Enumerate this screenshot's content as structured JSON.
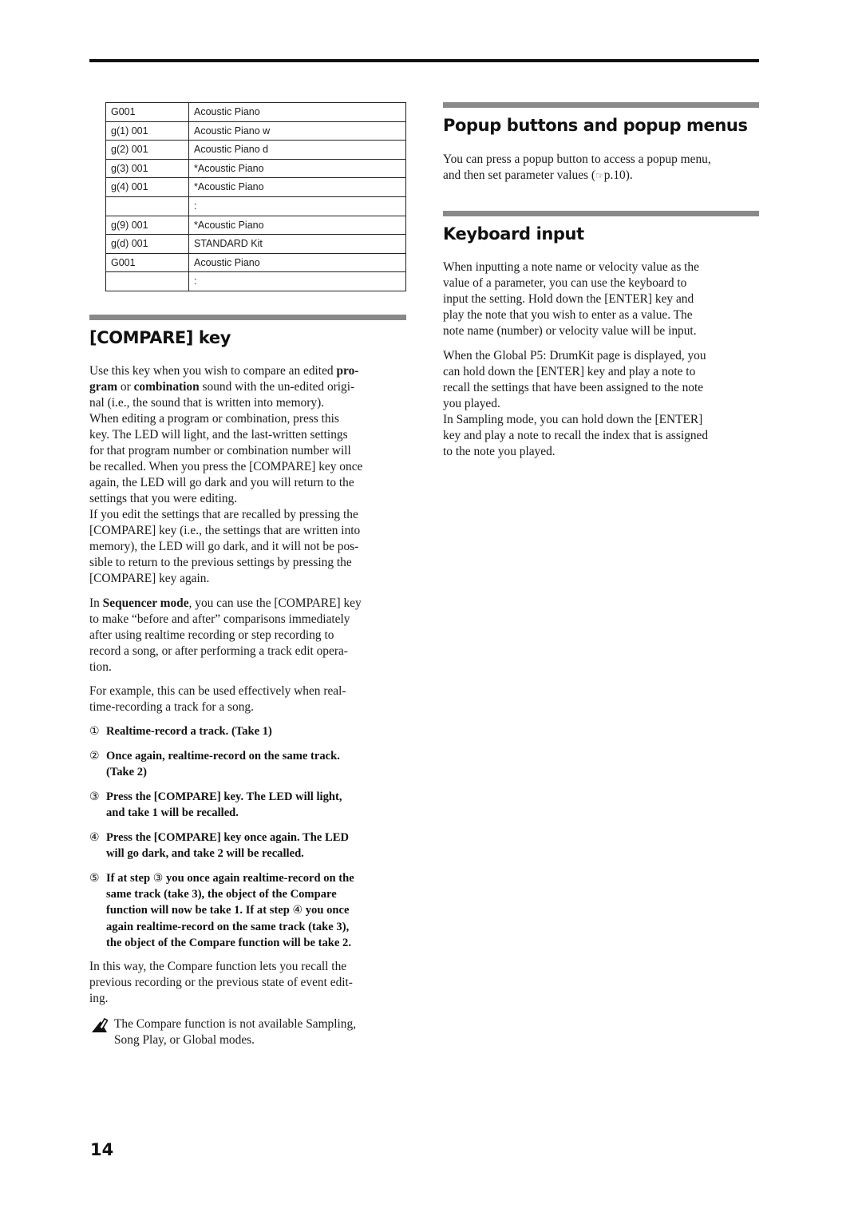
{
  "table": {
    "rows": [
      {
        "bank": "G001",
        "name": "Acoustic Piano"
      },
      {
        "bank": "g(1) 001",
        "name": "Acoustic Piano w"
      },
      {
        "bank": "g(2) 001",
        "name": "Acoustic Piano d"
      },
      {
        "bank": "g(3) 001",
        "name": "*Acoustic Piano"
      },
      {
        "bank": "g(4) 001",
        "name": "*Acoustic Piano"
      },
      {
        "bank": "",
        "name": ":"
      },
      {
        "bank": "g(9) 001",
        "name": "*Acoustic Piano"
      },
      {
        "bank": "g(d) 001",
        "name": "STANDARD Kit"
      },
      {
        "bank": "G001",
        "name": "Acoustic Piano"
      },
      {
        "bank": "",
        "name": ":"
      }
    ]
  },
  "compare": {
    "title": "[COMPARE] key",
    "p1": {
      "a": "Use this key when you wish to compare an edited ",
      "b1": "pro-",
      "b2": "gram",
      "c": " or ",
      "d": "combination",
      "e": " sound with the un-edited origi-",
      "f": "nal (i.e., the sound that is written into memory).",
      "g": "When editing a program or combination, press this",
      "h": "key. The LED will light, and the last-written settings",
      "i": "for that program number or combination number will",
      "j": "be recalled. When you press the [COMPARE] key once",
      "k": "again, the LED will go dark and you will return to the",
      "l": "settings that you were editing.",
      "m": "If you edit the settings that are recalled by pressing the",
      "n": "[COMPARE] key (i.e., the settings that are written into",
      "o": "memory), the LED will go dark, and it will not be pos-",
      "p": "sible to return to the previous settings by pressing the",
      "q": "[COMPARE] key again."
    },
    "p2": {
      "a": "In ",
      "b": "Sequencer mode",
      "c": ", you can use the [COMPARE] key",
      "d": "to make “before and after” comparisons immediately",
      "e": "after using realtime recording or step recording to",
      "f": "record a song, or after performing a track edit opera-",
      "g": "tion."
    },
    "p3": {
      "a": "For example, this can be used effectively when real-",
      "b": "time-recording a track for a song."
    },
    "steps": [
      {
        "num": "①",
        "l1": "Realtime-record a track. (Take 1)",
        "l2": ""
      },
      {
        "num": "②",
        "l1": "Once again, realtime-record on the same track.",
        "l2": "(Take 2)"
      },
      {
        "num": "③",
        "l1": "Press the [COMPARE] key. The LED will light,",
        "l2": "and take 1 will be recalled."
      },
      {
        "num": "④",
        "l1": "Press the [COMPARE] key once again. The LED",
        "l2": "will go dark, and take 2 will be recalled."
      }
    ],
    "step5": {
      "num": "⑤",
      "a": "If at step ",
      "ref1": "③",
      "b": " you once again realtime-record on the",
      "c": "same track (take 3), the object of the Compare",
      "d": "function will now be take 1. If at step ",
      "ref2": "④",
      "e": " you once",
      "f": "again realtime-record on the same track (take 3),",
      "g": "the object of the Compare function will be take 2."
    },
    "p4": {
      "a": "In this way, the Compare function lets you recall the",
      "b": "previous recording or the previous state of event edit-",
      "c": "ing."
    },
    "note": {
      "icon": "caution-icon",
      "a": "The Compare function is not available Sampling,",
      "b": "Song Play, or Global modes."
    }
  },
  "popup": {
    "title": "Popup buttons and popup menus",
    "a": "You can press a popup button to access a popup menu,",
    "b1": "and then set parameter values (",
    "ref_icon": "☞",
    "b2": "p.10)."
  },
  "keyboard": {
    "title": "Keyboard input",
    "p1": [
      "When inputting a note name or velocity value as the",
      "value of a parameter, you can use the keyboard to",
      "input the setting. Hold down the [ENTER] key and",
      "play the note that you wish to enter as a value. The",
      "note name (number) or velocity value will be input."
    ],
    "p2": [
      "When the Global P5: DrumKit page is displayed, you",
      "can hold down the [ENTER] key and play a note to",
      "recall the settings that have been assigned to the note",
      "you played.",
      "In Sampling mode, you can hold down the [ENTER]",
      "key and play a note to recall the index that is assigned",
      "to the note you played."
    ]
  },
  "page_number": "14"
}
